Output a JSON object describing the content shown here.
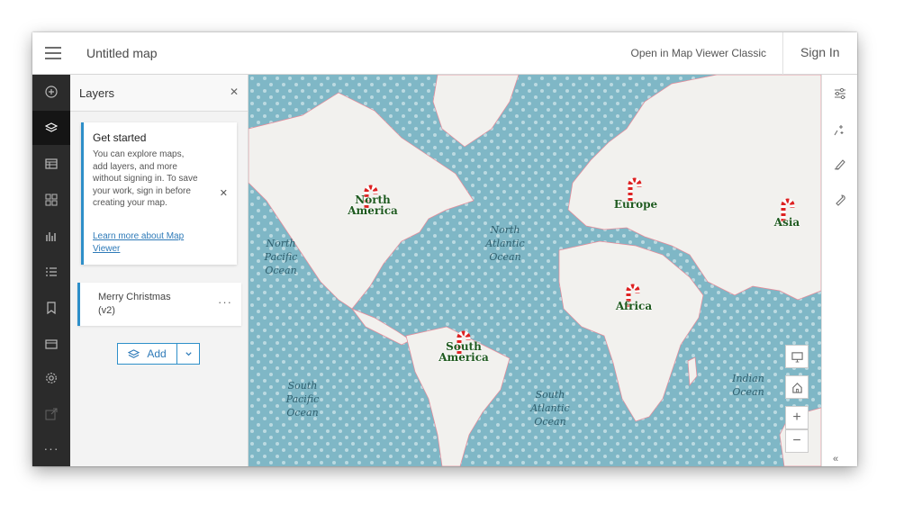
{
  "header": {
    "title": "Untitled map",
    "open_classic": "Open in Map Viewer Classic",
    "sign_in": "Sign In"
  },
  "panel": {
    "title": "Layers",
    "get_started": {
      "title": "Get started",
      "body": "You can explore maps, add layers, and more without signing in. To save your work, sign in before creating your map.",
      "link": "Learn more about Map Viewer"
    },
    "layers": [
      {
        "name": "Merry Christmas (v2)"
      }
    ],
    "add_label": "Add"
  },
  "map": {
    "continents": {
      "north_america": "North America",
      "south_america": "South America",
      "europe": "Europe",
      "africa": "Africa",
      "asia": "Asia"
    },
    "oceans": {
      "north_pacific": "North Pacific Ocean",
      "north_atlantic": "North Atlantic Ocean",
      "south_pacific": "South Pacific Ocean",
      "south_atlantic": "South Atlantic Ocean",
      "indian": "Indian Ocean"
    }
  },
  "colors": {
    "ocean": "#7fb7c6",
    "land": "#f2f1ee",
    "border": "#e87b8b",
    "accent": "#2e8fc9",
    "rail": "#2b2b2b"
  },
  "icons": {
    "rail": [
      "add-icon",
      "layers-icon",
      "table-icon",
      "basemap-icon",
      "charts-icon",
      "legend-icon",
      "bookmarks-icon",
      "folder-icon",
      "settings-icon",
      "share-icon",
      "more-icon"
    ],
    "right": [
      "properties-icon",
      "effects-icon",
      "sketch-icon",
      "tools-icon"
    ]
  }
}
